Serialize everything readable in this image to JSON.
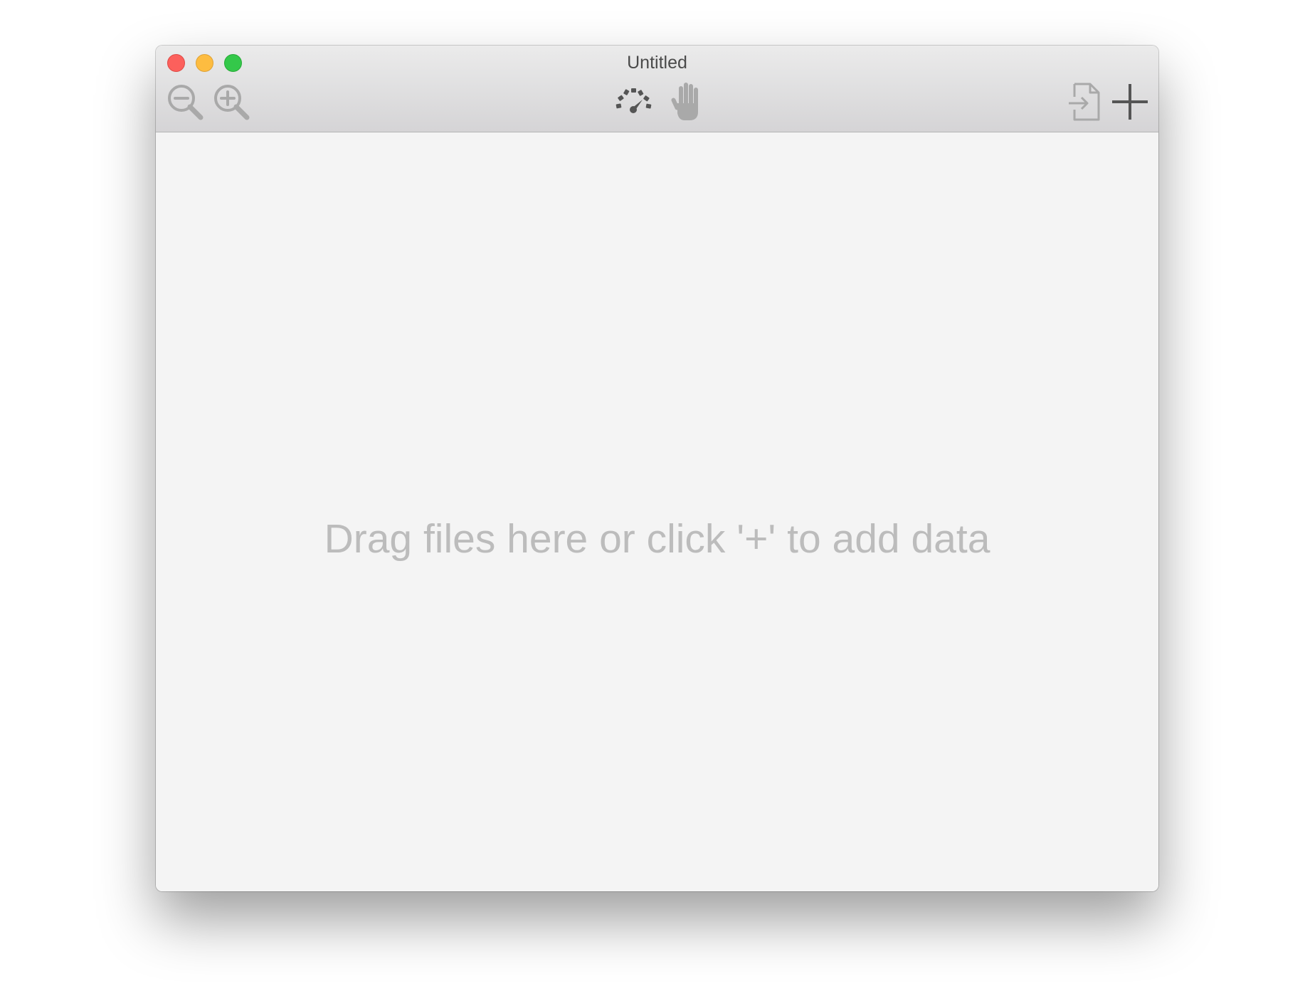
{
  "window": {
    "title": "Untitled"
  },
  "toolbar": {
    "left": [
      {
        "name": "zoom-out",
        "icon": "zoom-out-icon"
      },
      {
        "name": "zoom-in",
        "icon": "zoom-in-icon"
      }
    ],
    "center": [
      {
        "name": "speed",
        "icon": "speedometer-icon"
      },
      {
        "name": "pan",
        "icon": "hand-icon"
      }
    ],
    "right": [
      {
        "name": "import",
        "icon": "import-file-icon"
      },
      {
        "name": "add",
        "icon": "plus-icon"
      }
    ]
  },
  "content": {
    "empty_message": "Drag files here or click '+' to add data"
  },
  "colors": {
    "close": "#fc605c",
    "minimize": "#fdbc40",
    "maximize": "#34c84a",
    "placeholder_text": "#bcbcbc",
    "icon_gray": "#a9a9a9",
    "icon_dark": "#555555"
  }
}
